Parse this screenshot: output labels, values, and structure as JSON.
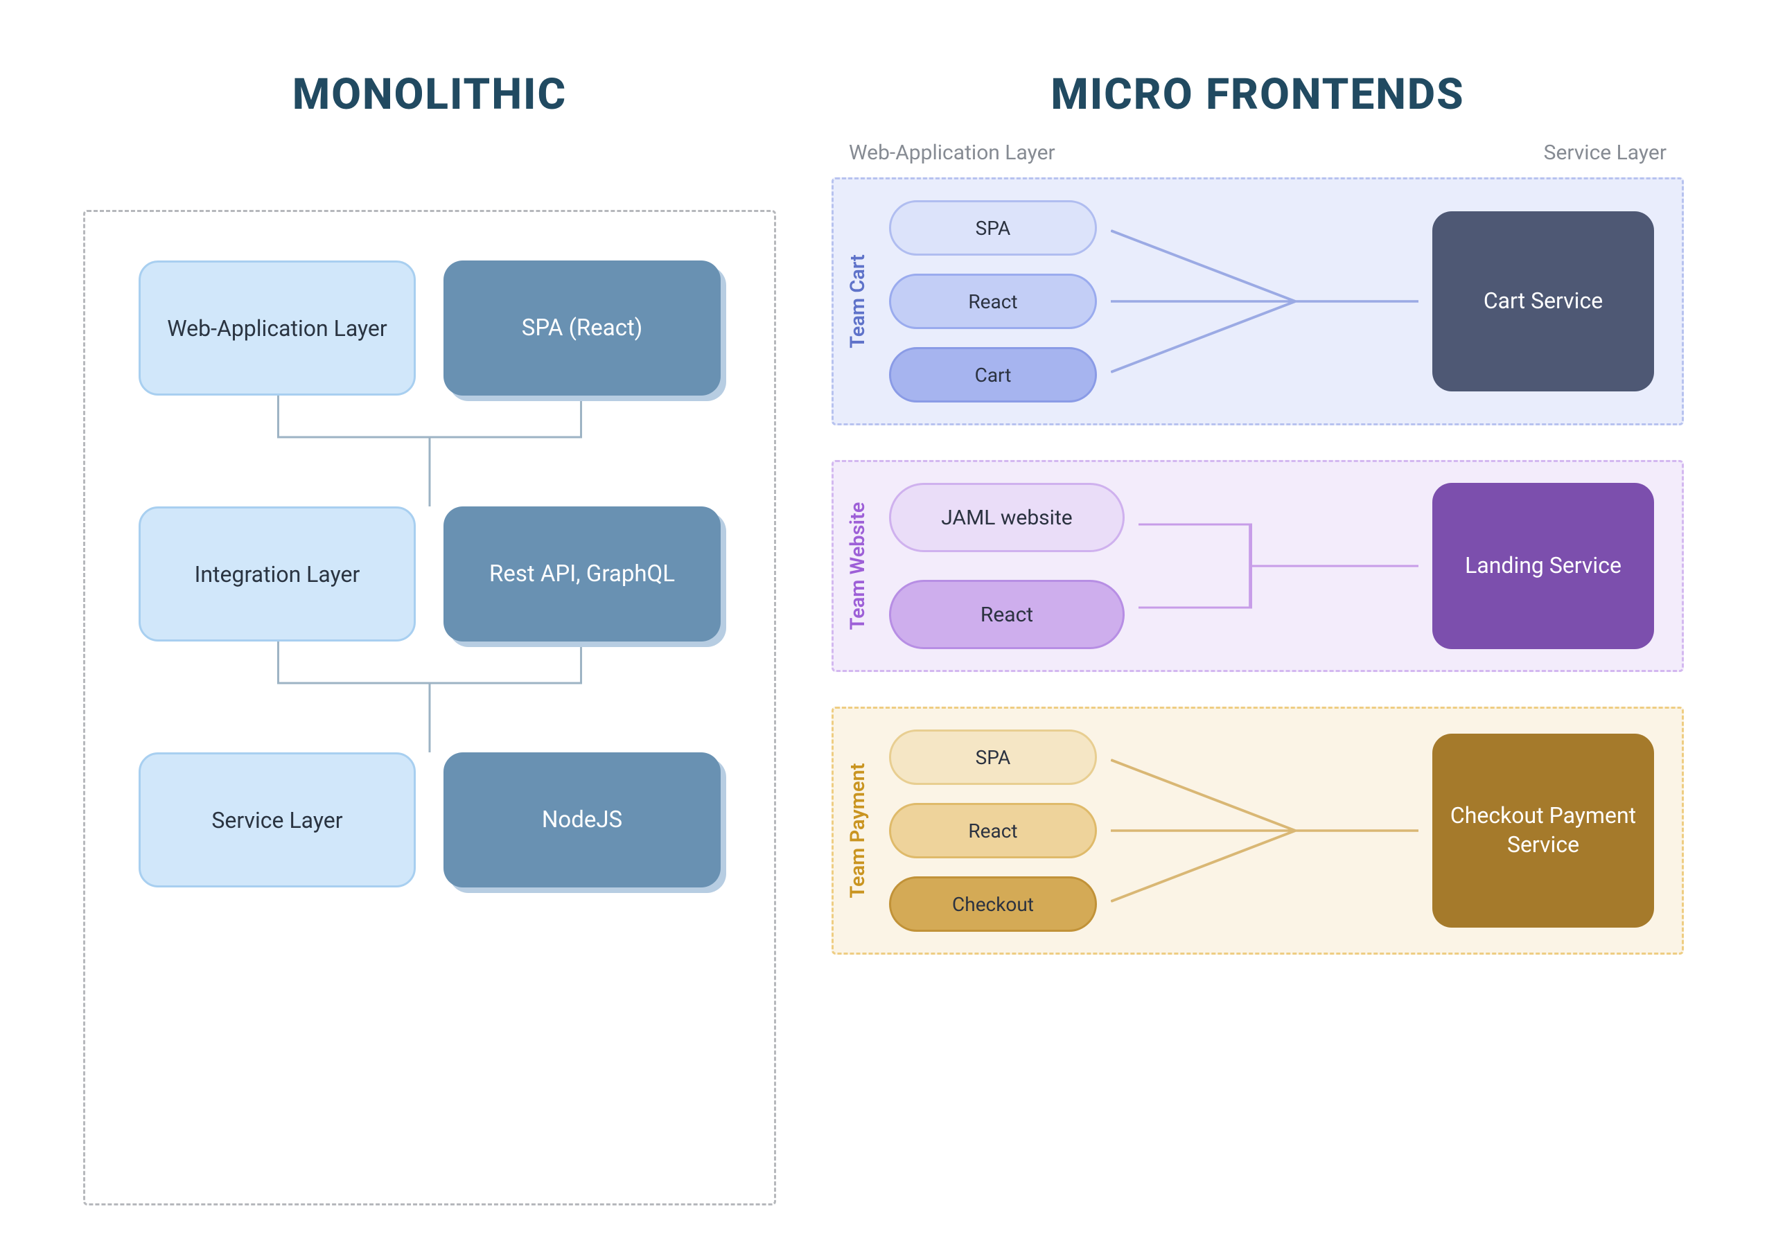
{
  "titles": {
    "left": "MONOLITHIC",
    "right": "MICRO FRONTENDS"
  },
  "monolithic": {
    "rows": [
      {
        "label": "Web-Application Layer",
        "tech": "SPA (React)"
      },
      {
        "label": "Integration Layer",
        "tech": "Rest API, GraphQL"
      },
      {
        "label": "Service Layer",
        "tech": "NodeJS"
      }
    ]
  },
  "mf_labels": {
    "left": "Web-Application Layer",
    "right": "Service Layer"
  },
  "teams": [
    {
      "id": "cart",
      "name": "Team Cart",
      "pills": [
        "SPA",
        "React",
        "Cart"
      ],
      "service": "Cart Service",
      "colors": {
        "conn": "#9baae4"
      }
    },
    {
      "id": "website",
      "name": "Team Website",
      "pills": [
        "JAML website",
        "React"
      ],
      "service": "Landing Service",
      "colors": {
        "conn": "#c79de8"
      }
    },
    {
      "id": "payment",
      "name": "Team Payment",
      "pills": [
        "SPA",
        "React",
        "Checkout"
      ],
      "service": "Checkout Payment Service",
      "colors": {
        "conn": "#d9b774"
      }
    }
  ]
}
